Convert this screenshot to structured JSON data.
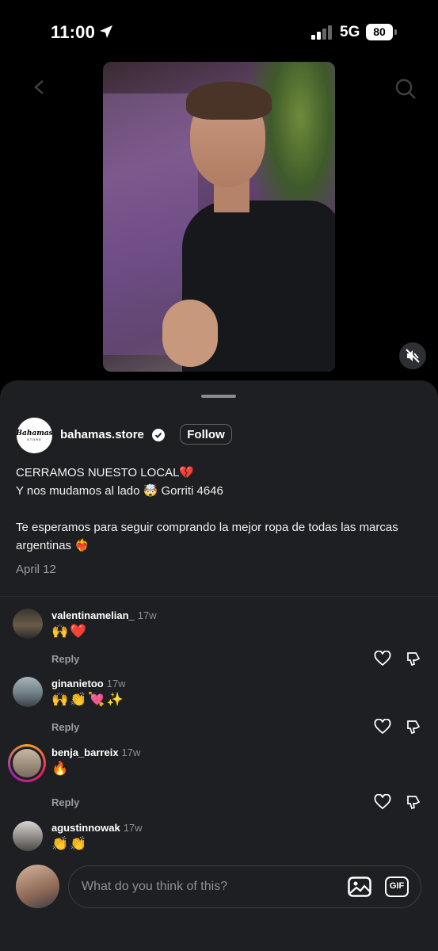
{
  "status_bar": {
    "time": "11:00",
    "network": "5G",
    "battery": "80"
  },
  "post": {
    "author": "bahamas.store",
    "avatar_brand": "Bahamas",
    "avatar_sub": "STORE",
    "follow_label": "Follow",
    "caption_line1": "CERRAMOS NUESTO LOCAL💔",
    "caption_line2": "Y nos mudamos al lado 🤯 Gorriti 4646",
    "caption_line3": "Te esperamos para seguir comprando la mejor ropa de todas las marcas argentinas ❤️‍🔥",
    "date": "April 12"
  },
  "comments": [
    {
      "user": "valentinamelian_",
      "time": "17w",
      "text": "🙌❤️",
      "reply": "Reply"
    },
    {
      "user": "ginanietoo",
      "time": "17w",
      "text": "🙌👏💘✨",
      "reply": "Reply"
    },
    {
      "user": "benja_barreix",
      "time": "17w",
      "text": "🔥",
      "reply": "Reply"
    },
    {
      "user": "agustinnowak",
      "time": "17w",
      "text": "👏👏"
    }
  ],
  "composer": {
    "placeholder": "What do you think of this?",
    "gif_label": "GIF"
  },
  "icons": [
    "location-arrow-icon",
    "signal-icon",
    "battery-icon",
    "back-icon",
    "search-icon",
    "mute-icon",
    "verified-icon",
    "heart-icon",
    "dislike-icon",
    "image-icon",
    "gif-icon"
  ]
}
